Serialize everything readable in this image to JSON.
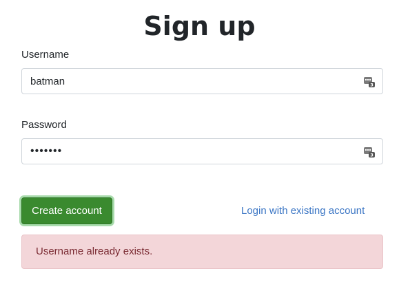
{
  "title": "Sign up",
  "username": {
    "label": "Username",
    "value": "batman"
  },
  "password": {
    "label": "Password",
    "value": "1234567"
  },
  "password_manager_icon": "password-manager-icon",
  "actions": {
    "create_label": "Create account",
    "login_label": "Login with existing account"
  },
  "alert": {
    "message": "Username already exists."
  },
  "colors": {
    "primary_button": "#3a8a2f",
    "link": "#3a75c4",
    "alert_bg": "#f3d6d9",
    "alert_text": "#7a2a32"
  }
}
